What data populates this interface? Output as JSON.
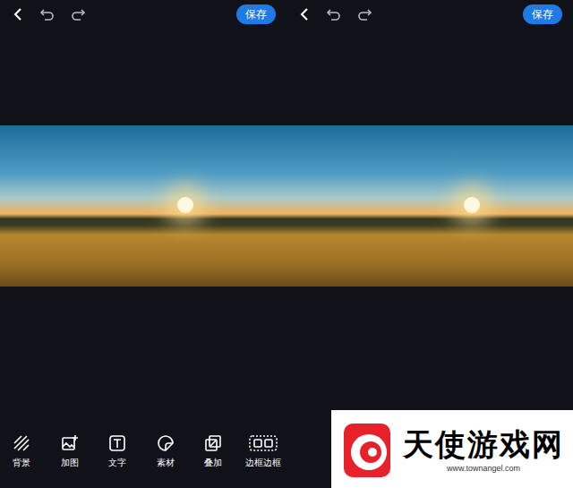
{
  "panels": [
    {
      "save": "保存",
      "tools": [
        {
          "label": "背景"
        },
        {
          "label": "加图"
        },
        {
          "label": "文字"
        },
        {
          "label": "素材"
        },
        {
          "label": "叠加"
        },
        {
          "label": "边框边框"
        }
      ]
    },
    {
      "save": "保存",
      "tools": []
    }
  ],
  "watermark": {
    "name": "天使游戏网",
    "url": "www.townangel.com"
  }
}
